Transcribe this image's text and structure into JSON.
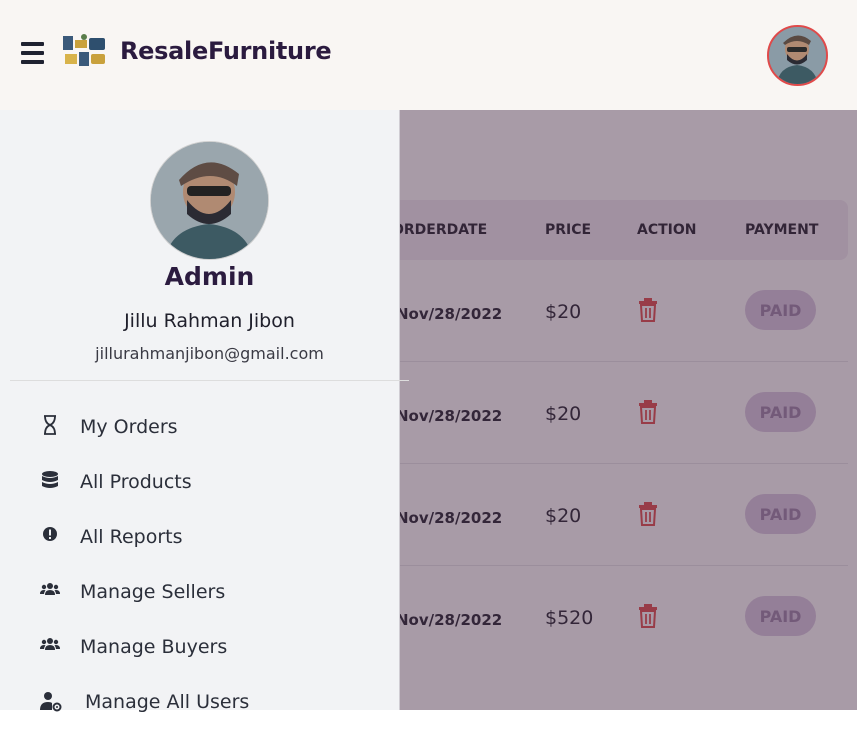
{
  "header": {
    "brand": "ResaleFurniture"
  },
  "table": {
    "columns": [
      "ORDERDATE",
      "PRICE",
      "ACTION",
      "PAYMENT"
    ],
    "rows": [
      {
        "date": "Nov/28/2022",
        "price": "$20",
        "payment": "PAID"
      },
      {
        "date": "Nov/28/2022",
        "price": "$20",
        "payment": "PAID"
      },
      {
        "date": "Nov/28/2022",
        "price": "$20",
        "payment": "PAID"
      },
      {
        "date": "Nov/28/2022",
        "price": "$520",
        "payment": "PAID"
      }
    ]
  },
  "sidebar": {
    "role": "Admin",
    "name": "Jillu Rahman Jibon",
    "email": "jillurahmanjibon@gmail.com",
    "items": [
      {
        "label": "My Orders",
        "icon": "hourglass-icon"
      },
      {
        "label": "All Products",
        "icon": "database-icon"
      },
      {
        "label": "All Reports",
        "icon": "alert-circle-icon"
      },
      {
        "label": "Manage Sellers",
        "icon": "users-icon"
      },
      {
        "label": "Manage Buyers",
        "icon": "users-icon"
      },
      {
        "label": "Manage All Users",
        "icon": "user-gear-icon"
      }
    ]
  },
  "colors": {
    "brand_text": "#2b1b3f",
    "avatar_ring": "#e04a4a",
    "overlay": "#492d48",
    "trash": "#e04a4a",
    "paid_badge": "#d9c9e2"
  }
}
